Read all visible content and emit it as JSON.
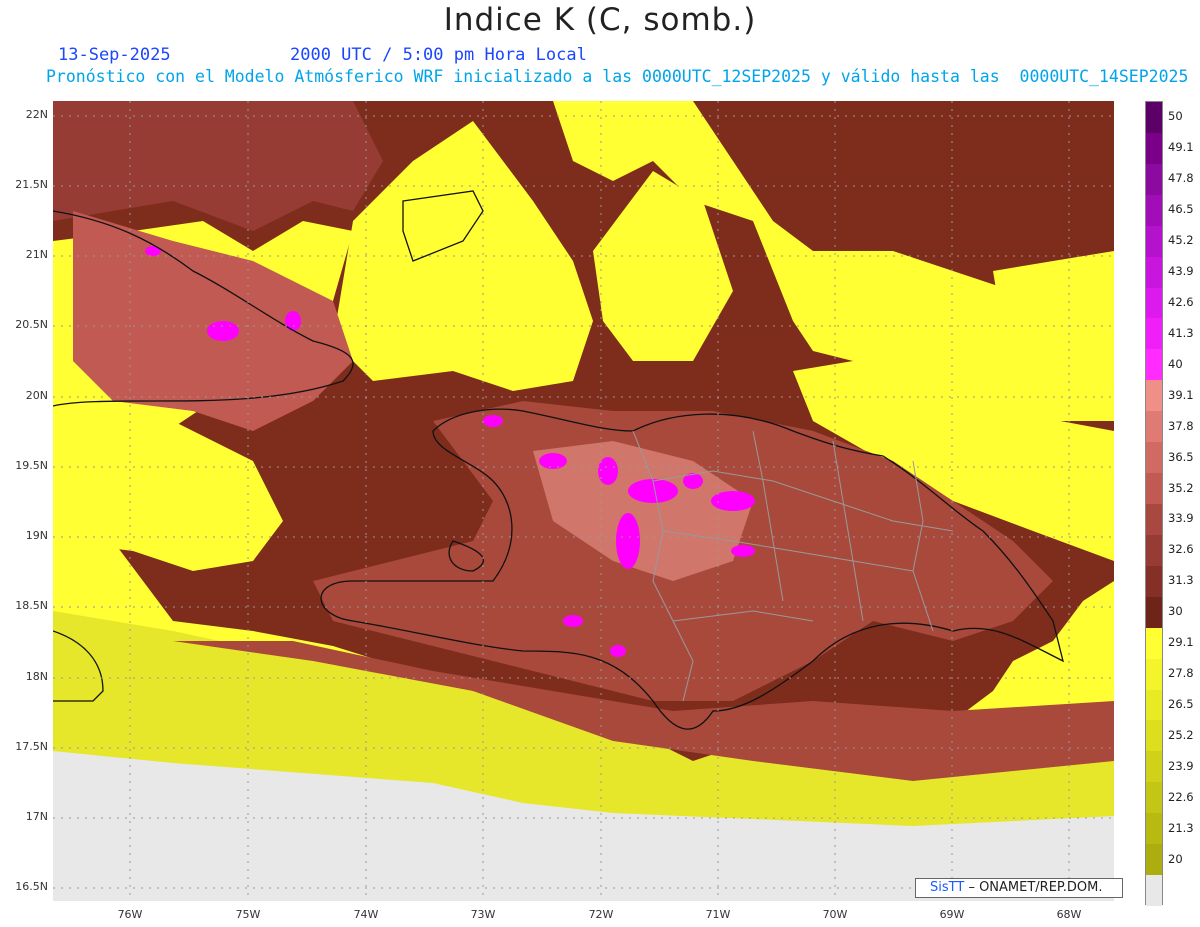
{
  "header": {
    "title": "Indice K (C, somb.)",
    "date": "13-Sep-2025",
    "time": "2000 UTC / 5:00 pm Hora Local",
    "subtitle": "Pronóstico con el Modelo Atmósferico WRF inicializado a las 0000UTC_12SEP2025 y válido hasta las  0000UTC_14SEP2025"
  },
  "axes": {
    "lat_labels": [
      "22N",
      "21.5N",
      "21N",
      "20.5N",
      "20N",
      "19.5N",
      "19N",
      "18.5N",
      "18N",
      "17.5N",
      "17N",
      "16.5N"
    ],
    "lon_labels": [
      "76W",
      "75W",
      "74W",
      "73W",
      "72W",
      "71W",
      "70W",
      "69W",
      "68W"
    ]
  },
  "colorbar": {
    "labels": [
      "50",
      "49.1",
      "47.8",
      "46.5",
      "45.2",
      "43.9",
      "42.6",
      "41.3",
      "40",
      "39.1",
      "37.8",
      "36.5",
      "35.2",
      "33.9",
      "32.6",
      "31.3",
      "30",
      "29.1",
      "27.8",
      "26.5",
      "25.2",
      "23.9",
      "22.6",
      "21.3",
      "20"
    ],
    "colors": [
      "#5c0068",
      "#7a0088",
      "#8d0aa0",
      "#a10eb8",
      "#b412cc",
      "#c816de",
      "#dc1aee",
      "#f01ef8",
      "#ff2bff",
      "#f08e88",
      "#e07a74",
      "#d06a62",
      "#c05a52",
      "#a84840",
      "#963c34",
      "#843026",
      "#6e2418",
      "#ffff33",
      "#f4f42a",
      "#e8ea24",
      "#dcde1e",
      "#d0d21a",
      "#c4c616",
      "#b8ba12",
      "#acae10"
    ],
    "bottom_color": "#e8e8e8"
  },
  "map_colors": {
    "land_missing": "#e8e8e8",
    "yellow": "#ffff33",
    "dark_brown": "#7e2c1c",
    "brown": "#a8493c",
    "salmon": "#d0766a",
    "magenta": "#ff00ff",
    "coast": "#111111",
    "provinces": "#999999"
  },
  "credit": {
    "sis": "SisTT",
    "text": "– ONAMET/REP.DOM."
  }
}
